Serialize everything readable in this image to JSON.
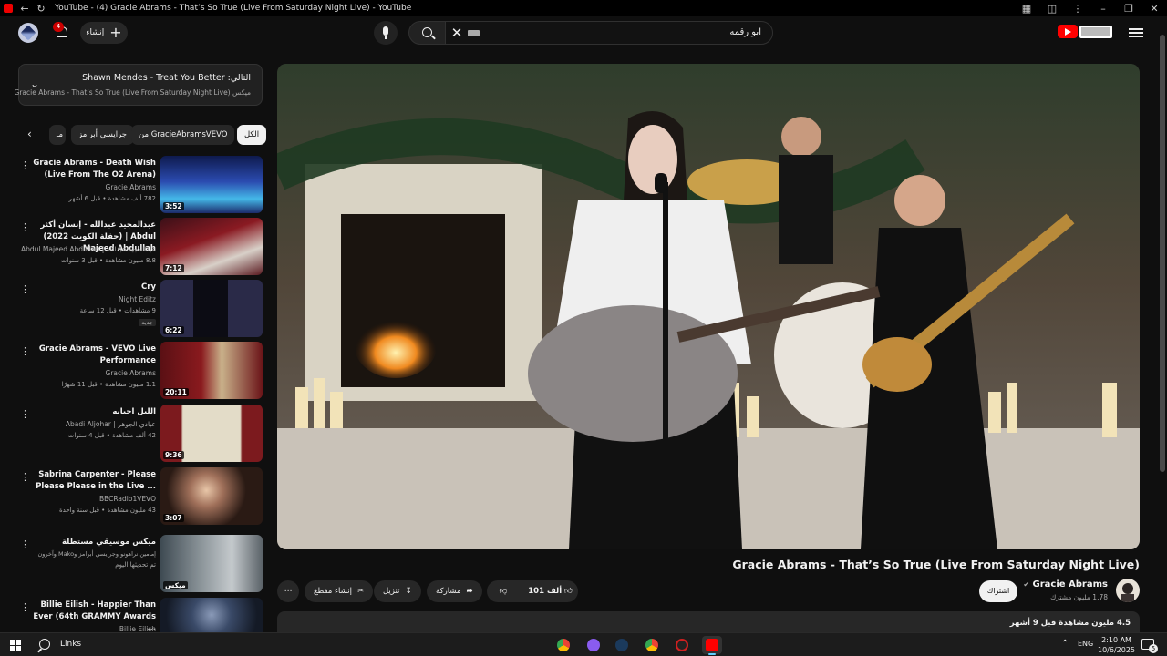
{
  "window": {
    "title": "YouTube - (4) Gracie Abrams - That’s So True (Live From Saturday Night Live) - YouTube"
  },
  "header": {
    "search_query": "ابو رقمه",
    "create_label": "إنشاء",
    "notification_count": "4"
  },
  "queue": {
    "next_label": "التالي: Shawn Mendes - Treat You Better",
    "subtitle": "ميكس Gracie Abrams - That’s So True (Live From Saturday Night Live)"
  },
  "chips": [
    {
      "label": "الكل",
      "active": true
    },
    {
      "label": "من GracieAbramsVEVO",
      "active": false
    },
    {
      "label": "جرايسي أبرامز",
      "active": false
    },
    {
      "label": "مـ",
      "active": false
    }
  ],
  "related": [
    {
      "title": "Gracie Abrams - Death Wish (Live From The O2 Arena)",
      "channel": "Gracie Abrams",
      "meta": "782 ألف مشاهدة • قبل 6 أشهر",
      "duration": "3:52",
      "thumb_colors": [
        "#1a2f7a",
        "#3fb6e6"
      ]
    },
    {
      "title": "عبدالمجيد عبدالله - إنسان أكثر (حفلة الكويت 2022) | Abdul Majeed Abdullah",
      "channel": "عبدالمجيد عبدالله | Abdul Majeed Abdullah",
      "meta": "8.8 مليون مشاهدة • قبل 3 سنوات",
      "duration": "7:12",
      "thumb_colors": [
        "#8a1a22",
        "#d8d0c8"
      ]
    },
    {
      "title": "Cry",
      "channel": "Night Editz",
      "meta": "9 مشاهدات • قبل 12 ساعة",
      "duration": "6:22",
      "badge": "جديد",
      "thumb_colors": [
        "#2a2a48",
        "#101018"
      ]
    },
    {
      "title": "Gracie Abrams - VEVO Live Performance",
      "channel": "Gracie Abrams",
      "meta": "1.1 مليون مشاهدة • قبل 11 شهرًا",
      "duration": "20:11",
      "thumb_colors": [
        "#6b1418",
        "#c9b18a"
      ]
    },
    {
      "title": "الليل احبابه",
      "channel": "عبادي الجوهر | Abadi Aljohar",
      "meta": "42 ألف مشاهدة • قبل 4 سنوات",
      "duration": "9:36",
      "thumb_colors": [
        "#7c1a1e",
        "#e3dcc8"
      ]
    },
    {
      "title": "Sabrina Carpenter - Please Please Please in the Live ...",
      "channel": "BBCRadio1VEVO",
      "meta": "43 مليون مشاهدة • قبل سنة واحدة",
      "duration": "3:07",
      "thumb_colors": [
        "#2a1a14",
        "#e8c6a8"
      ]
    },
    {
      "title": "ميكس موسيقي مستطلة",
      "channel": "إمامين نراهونو وجرايسي أبرامز وMako وآخرون",
      "meta": "تم تحديثها اليوم",
      "duration": "",
      "label_overlay": "ميكس",
      "thumb_colors": [
        "#3e4a52",
        "#c4c9cc"
      ]
    },
    {
      "title": "Billie Eilish - Happier Than Ever (64th GRAMMY Awards ...",
      "channel": "Billie Eilish",
      "meta": "",
      "duration": "",
      "thumb_colors": [
        "#1a2230",
        "#5a6a88"
      ]
    }
  ],
  "video": {
    "title": "Gracie Abrams - That’s So True (Live From Saturday Night Live)",
    "channel": "Gracie Abrams",
    "subscribers": "1.78 مليون مشترك",
    "subscribe_label": "اشتراك",
    "like_count": "101 ألف",
    "share_label": "مشاركة",
    "download_label": "تنزيل",
    "clip_label": "إنشاء مقطع",
    "views_line": "4.5 مليون مشاهدة قبل 9 أشهر"
  },
  "taskbar": {
    "search_label": "Links",
    "lang": "ENG",
    "time": "2:10 AM",
    "date": "10/6/2025",
    "notification_count": "5",
    "apps": [
      {
        "name": "chrome-app",
        "color": "#e8b43a"
      },
      {
        "name": "messenger-app",
        "color": "#8a5cf0"
      },
      {
        "name": "steam-app",
        "color": "#1b3a5c"
      },
      {
        "name": "chrome-profile-app",
        "color": "#34a853"
      },
      {
        "name": "media-app",
        "color": "#d02020"
      },
      {
        "name": "youtube-app",
        "color": "#ff0000"
      }
    ]
  },
  "colors": {
    "background": "#0f0f0f",
    "youtube_red": "#ff0000",
    "chip_bg": "#272727"
  }
}
